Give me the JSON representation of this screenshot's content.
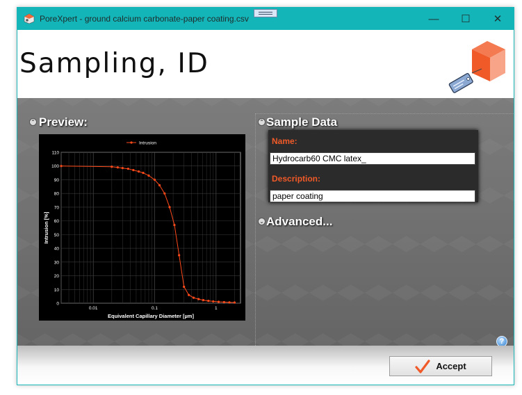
{
  "window": {
    "title": "PoreXpert - ground calcium carbonate-paper coating.csv",
    "controls": {
      "minimize": "—",
      "maximize": "☐",
      "close": "✕"
    }
  },
  "header": {
    "heading": "Sampling, ID"
  },
  "preview": {
    "title": "Preview:",
    "chart_data": {
      "type": "line",
      "title": "",
      "xlabel": "Equivalent Capillary Diameter [µm]",
      "ylabel": "Intrusion [%]",
      "x_scale": "log",
      "xlim": [
        0.003,
        2.5
      ],
      "ylim": [
        0,
        110
      ],
      "x_ticks": [
        0.01,
        0.1,
        1
      ],
      "x_tick_labels": [
        "0.01",
        "0.1",
        "1"
      ],
      "y_ticks": [
        0,
        10,
        20,
        30,
        40,
        50,
        60,
        70,
        80,
        90,
        100,
        110
      ],
      "grid": true,
      "legend": "top-center",
      "series": [
        {
          "name": "Intrusion",
          "color": "#ff4a1a",
          "points": [
            [
              0.003,
              100
            ],
            [
              0.02,
              99.5
            ],
            [
              0.025,
              99
            ],
            [
              0.03,
              98.5
            ],
            [
              0.037,
              98
            ],
            [
              0.045,
              97
            ],
            [
              0.055,
              96
            ],
            [
              0.065,
              95
            ],
            [
              0.08,
              93
            ],
            [
              0.1,
              90
            ],
            [
              0.12,
              86
            ],
            [
              0.145,
              80
            ],
            [
              0.175,
              70
            ],
            [
              0.21,
              57
            ],
            [
              0.25,
              35
            ],
            [
              0.3,
              12
            ],
            [
              0.36,
              6
            ],
            [
              0.43,
              4
            ],
            [
              0.52,
              3
            ],
            [
              0.62,
              2.2
            ],
            [
              0.75,
              1.7
            ],
            [
              0.9,
              1.3
            ],
            [
              1.1,
              1
            ],
            [
              1.35,
              0.8
            ],
            [
              1.65,
              0.6
            ],
            [
              2.0,
              0.5
            ]
          ]
        }
      ]
    }
  },
  "sample": {
    "title": "Sample Data",
    "name_label": "Name:",
    "name_value": "Hydrocarb60 CMC latex_",
    "description_label": "Description:",
    "description_value": "paper coating"
  },
  "advanced": {
    "title": "Advanced..."
  },
  "help": {
    "glyph": "?"
  },
  "footer": {
    "accept_label": "Accept"
  },
  "colors": {
    "titlebar": "#13b5b8",
    "accent": "#f05a28",
    "series": "#ff4a1a"
  }
}
